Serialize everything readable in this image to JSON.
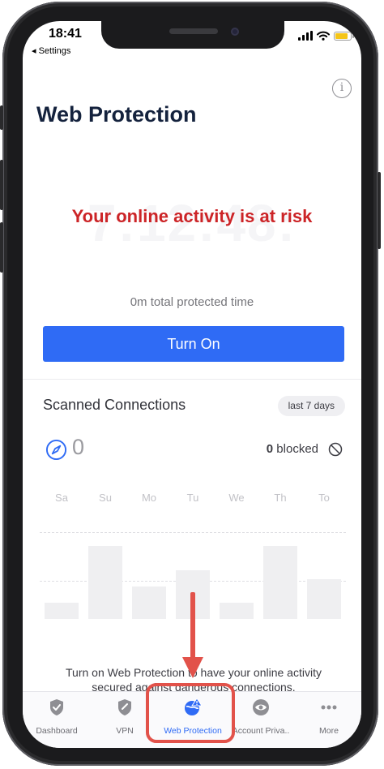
{
  "status_bar": {
    "time": "18:41",
    "back_label": "◂ Settings"
  },
  "header": {
    "title": "Web Protection",
    "info_icon": "info-icon"
  },
  "hero": {
    "timer_watermark": "7:12:48:",
    "risk_message": "Your online activity is at risk",
    "protected_time": "0m total protected time",
    "button_label": "Turn On"
  },
  "scanned": {
    "title": "Scanned Connections",
    "range_label": "last 7 days",
    "count": "0",
    "blocked_count": "0",
    "blocked_label": "blocked",
    "days": [
      "Sa",
      "Su",
      "Mo",
      "Tu",
      "We",
      "Th",
      "To"
    ],
    "bar_levels": [
      0.17,
      0.77,
      0.34,
      0.51,
      0.17,
      0.77,
      0.42
    ]
  },
  "footer": {
    "line1": "Turn on Web Protection to have your online activity",
    "line2": "secured against dangerous connections."
  },
  "tabs": [
    {
      "label": "Dashboard",
      "icon": "shield-check-icon"
    },
    {
      "label": "VPN",
      "icon": "shield-link-icon"
    },
    {
      "label": "Web Protection",
      "icon": "globe-warning-icon"
    },
    {
      "label": "Account Priva..",
      "icon": "eye-icon"
    },
    {
      "label": "More",
      "icon": "more-dots-icon"
    }
  ],
  "colors": {
    "accent": "#2f6bf5",
    "risk": "#cc2427",
    "annotation": "#e2524a",
    "battery": "#f5c518"
  }
}
